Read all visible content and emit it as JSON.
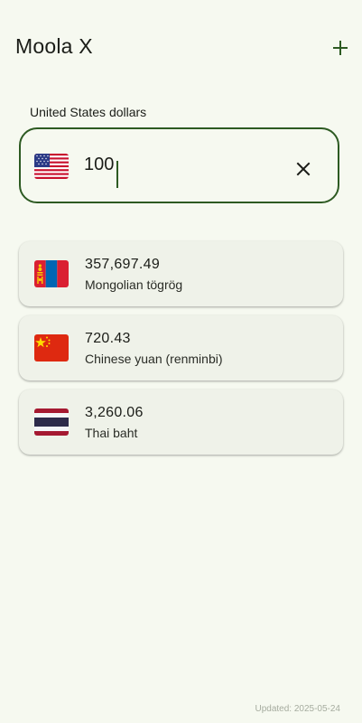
{
  "app": {
    "title": "Moola X",
    "add_icon": "plus-icon"
  },
  "input": {
    "label": "United States dollars",
    "value": "100",
    "flag": "us-flag-icon",
    "clear_icon": "close-icon"
  },
  "conversions": [
    {
      "value": "357,697.49",
      "name": "Mongolian tögrög",
      "flag": "mongolia-flag-icon"
    },
    {
      "value": "720.43",
      "name": "Chinese yuan (renminbi)",
      "flag": "china-flag-icon"
    },
    {
      "value": "3,260.06",
      "name": "Thai baht",
      "flag": "thailand-flag-icon"
    }
  ],
  "footer": {
    "updated": "Updated: 2025-05-24"
  },
  "colors": {
    "background": "#f6f9f0",
    "accent": "#2d5a22",
    "card": "#eff2e9",
    "muted_text": "#a6ac9f"
  }
}
